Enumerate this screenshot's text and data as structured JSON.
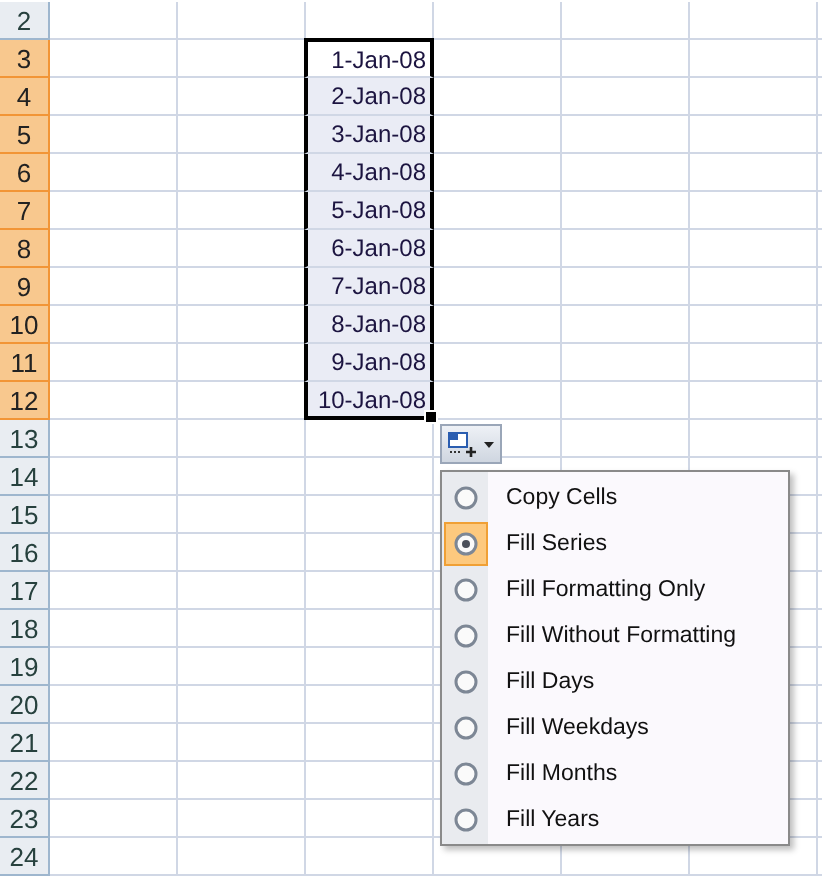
{
  "rows": [
    {
      "number": "2",
      "selected": false
    },
    {
      "number": "3",
      "selected": true,
      "column_4": "1-Jan-08",
      "active": true
    },
    {
      "number": "4",
      "selected": true,
      "column_4": "2-Jan-08",
      "active": false
    },
    {
      "number": "5",
      "selected": true,
      "column_4": "3-Jan-08",
      "active": false
    },
    {
      "number": "6",
      "selected": true,
      "column_4": "4-Jan-08",
      "active": false
    },
    {
      "number": "7",
      "selected": true,
      "column_4": "5-Jan-08",
      "active": false
    },
    {
      "number": "8",
      "selected": true,
      "column_4": "6-Jan-08",
      "active": false
    },
    {
      "number": "9",
      "selected": true,
      "column_4": "7-Jan-08",
      "active": false
    },
    {
      "number": "10",
      "selected": true,
      "column_4": "8-Jan-08",
      "active": false
    },
    {
      "number": "11",
      "selected": true,
      "column_4": "9-Jan-08",
      "active": false
    },
    {
      "number": "12",
      "selected": true,
      "column_4": "10-Jan-08",
      "active": false
    },
    {
      "number": "13",
      "selected": false
    },
    {
      "number": "14",
      "selected": false
    },
    {
      "number": "15",
      "selected": false
    },
    {
      "number": "16",
      "selected": false
    },
    {
      "number": "17",
      "selected": false
    },
    {
      "number": "18",
      "selected": false
    },
    {
      "number": "19",
      "selected": false
    },
    {
      "number": "20",
      "selected": false
    },
    {
      "number": "21",
      "selected": false
    },
    {
      "number": "22",
      "selected": false
    },
    {
      "number": "23",
      "selected": false
    },
    {
      "number": "24",
      "selected": false
    }
  ],
  "fill_options_menu": {
    "items": [
      {
        "label": "Copy Cells",
        "selected": false
      },
      {
        "label": "Fill Series",
        "selected": true
      },
      {
        "label": "Fill Formatting Only",
        "selected": false
      },
      {
        "label": "Fill Without Formatting",
        "selected": false
      },
      {
        "label": "Fill Days",
        "selected": false
      },
      {
        "label": "Fill Weekdays",
        "selected": false
      },
      {
        "label": "Fill Months",
        "selected": false
      },
      {
        "label": "Fill Years",
        "selected": false
      }
    ]
  }
}
